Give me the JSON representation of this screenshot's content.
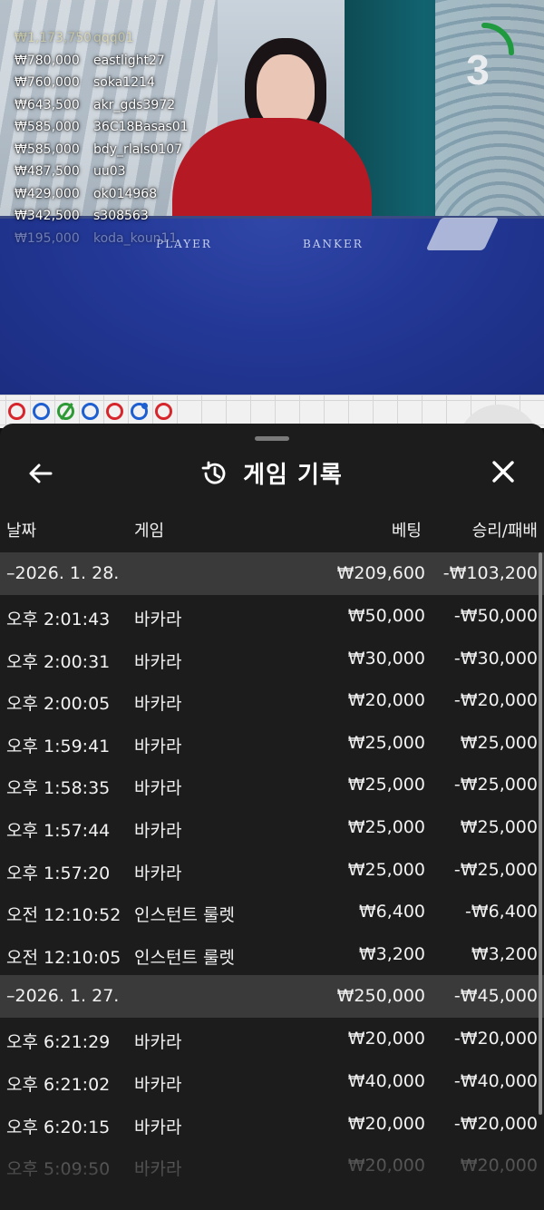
{
  "live_feed": {
    "winners": [
      {
        "amount": "₩1,173,750",
        "user": "qqq01"
      },
      {
        "amount": "₩780,000",
        "user": "eastlight27"
      },
      {
        "amount": "₩760,000",
        "user": "soka1214"
      },
      {
        "amount": "₩643,500",
        "user": "akr_gds3972"
      },
      {
        "amount": "₩585,000",
        "user": "36C18Basas01"
      },
      {
        "amount": "₩585,000",
        "user": "bdy_rlals0107"
      },
      {
        "amount": "₩487,500",
        "user": "uu03"
      },
      {
        "amount": "₩429,000",
        "user": "ok014968"
      },
      {
        "amount": "₩342,500",
        "user": "s308563"
      },
      {
        "amount": "₩195,000",
        "user": "koda_koun11"
      }
    ],
    "countdown": "3",
    "countdown_progress": 0.25,
    "table_labels": {
      "player": "PLAYER",
      "banker": "BANKER"
    }
  },
  "bead_road": [
    "red",
    "blue",
    "green",
    "blue",
    "red",
    "blue",
    "red"
  ],
  "colors": {
    "banker": "#d6262c",
    "player": "#1d5fd0",
    "tie": "#2d9a35",
    "timer": "#1f9a3e"
  },
  "sheet": {
    "title": "게임 기록",
    "back_icon": "arrow-left-icon",
    "history_icon": "history-clock-icon",
    "close_icon": "close-icon",
    "columns": {
      "date": "날짜",
      "game": "게임",
      "bet": "베팅",
      "result": "승리/패배"
    }
  },
  "history": [
    {
      "date": "–2026. 1. 28.",
      "bet": "₩209,600",
      "result": "-₩103,200",
      "items": [
        {
          "time": "오후 2:01:43",
          "game": "바카라",
          "bet": "₩50,000",
          "result": "-₩50,000"
        },
        {
          "time": "오후 2:00:31",
          "game": "바카라",
          "bet": "₩30,000",
          "result": "-₩30,000"
        },
        {
          "time": "오후 2:00:05",
          "game": "바카라",
          "bet": "₩20,000",
          "result": "-₩20,000"
        },
        {
          "time": "오후 1:59:41",
          "game": "바카라",
          "bet": "₩25,000",
          "result": "₩25,000"
        },
        {
          "time": "오후 1:58:35",
          "game": "바카라",
          "bet": "₩25,000",
          "result": "-₩25,000"
        },
        {
          "time": "오후 1:57:44",
          "game": "바카라",
          "bet": "₩25,000",
          "result": "₩25,000"
        },
        {
          "time": "오후 1:57:20",
          "game": "바카라",
          "bet": "₩25,000",
          "result": "-₩25,000"
        },
        {
          "time": "오전 12:10:52",
          "game": "인스턴트 룰렛",
          "bet": "₩6,400",
          "result": "-₩6,400"
        },
        {
          "time": "오전 12:10:05",
          "game": "인스턴트 룰렛",
          "bet": "₩3,200",
          "result": "₩3,200"
        }
      ]
    },
    {
      "date": "–2026. 1. 27.",
      "bet": "₩250,000",
      "result": "-₩45,000",
      "items": [
        {
          "time": "오후 6:21:29",
          "game": "바카라",
          "bet": "₩20,000",
          "result": "-₩20,000"
        },
        {
          "time": "오후 6:21:02",
          "game": "바카라",
          "bet": "₩40,000",
          "result": "-₩40,000"
        },
        {
          "time": "오후 6:20:15",
          "game": "바카라",
          "bet": "₩20,000",
          "result": "-₩20,000"
        },
        {
          "time": "오후 5:09:50",
          "game": "바카라",
          "bet": "₩20,000",
          "result": "₩20,000"
        }
      ]
    }
  ]
}
